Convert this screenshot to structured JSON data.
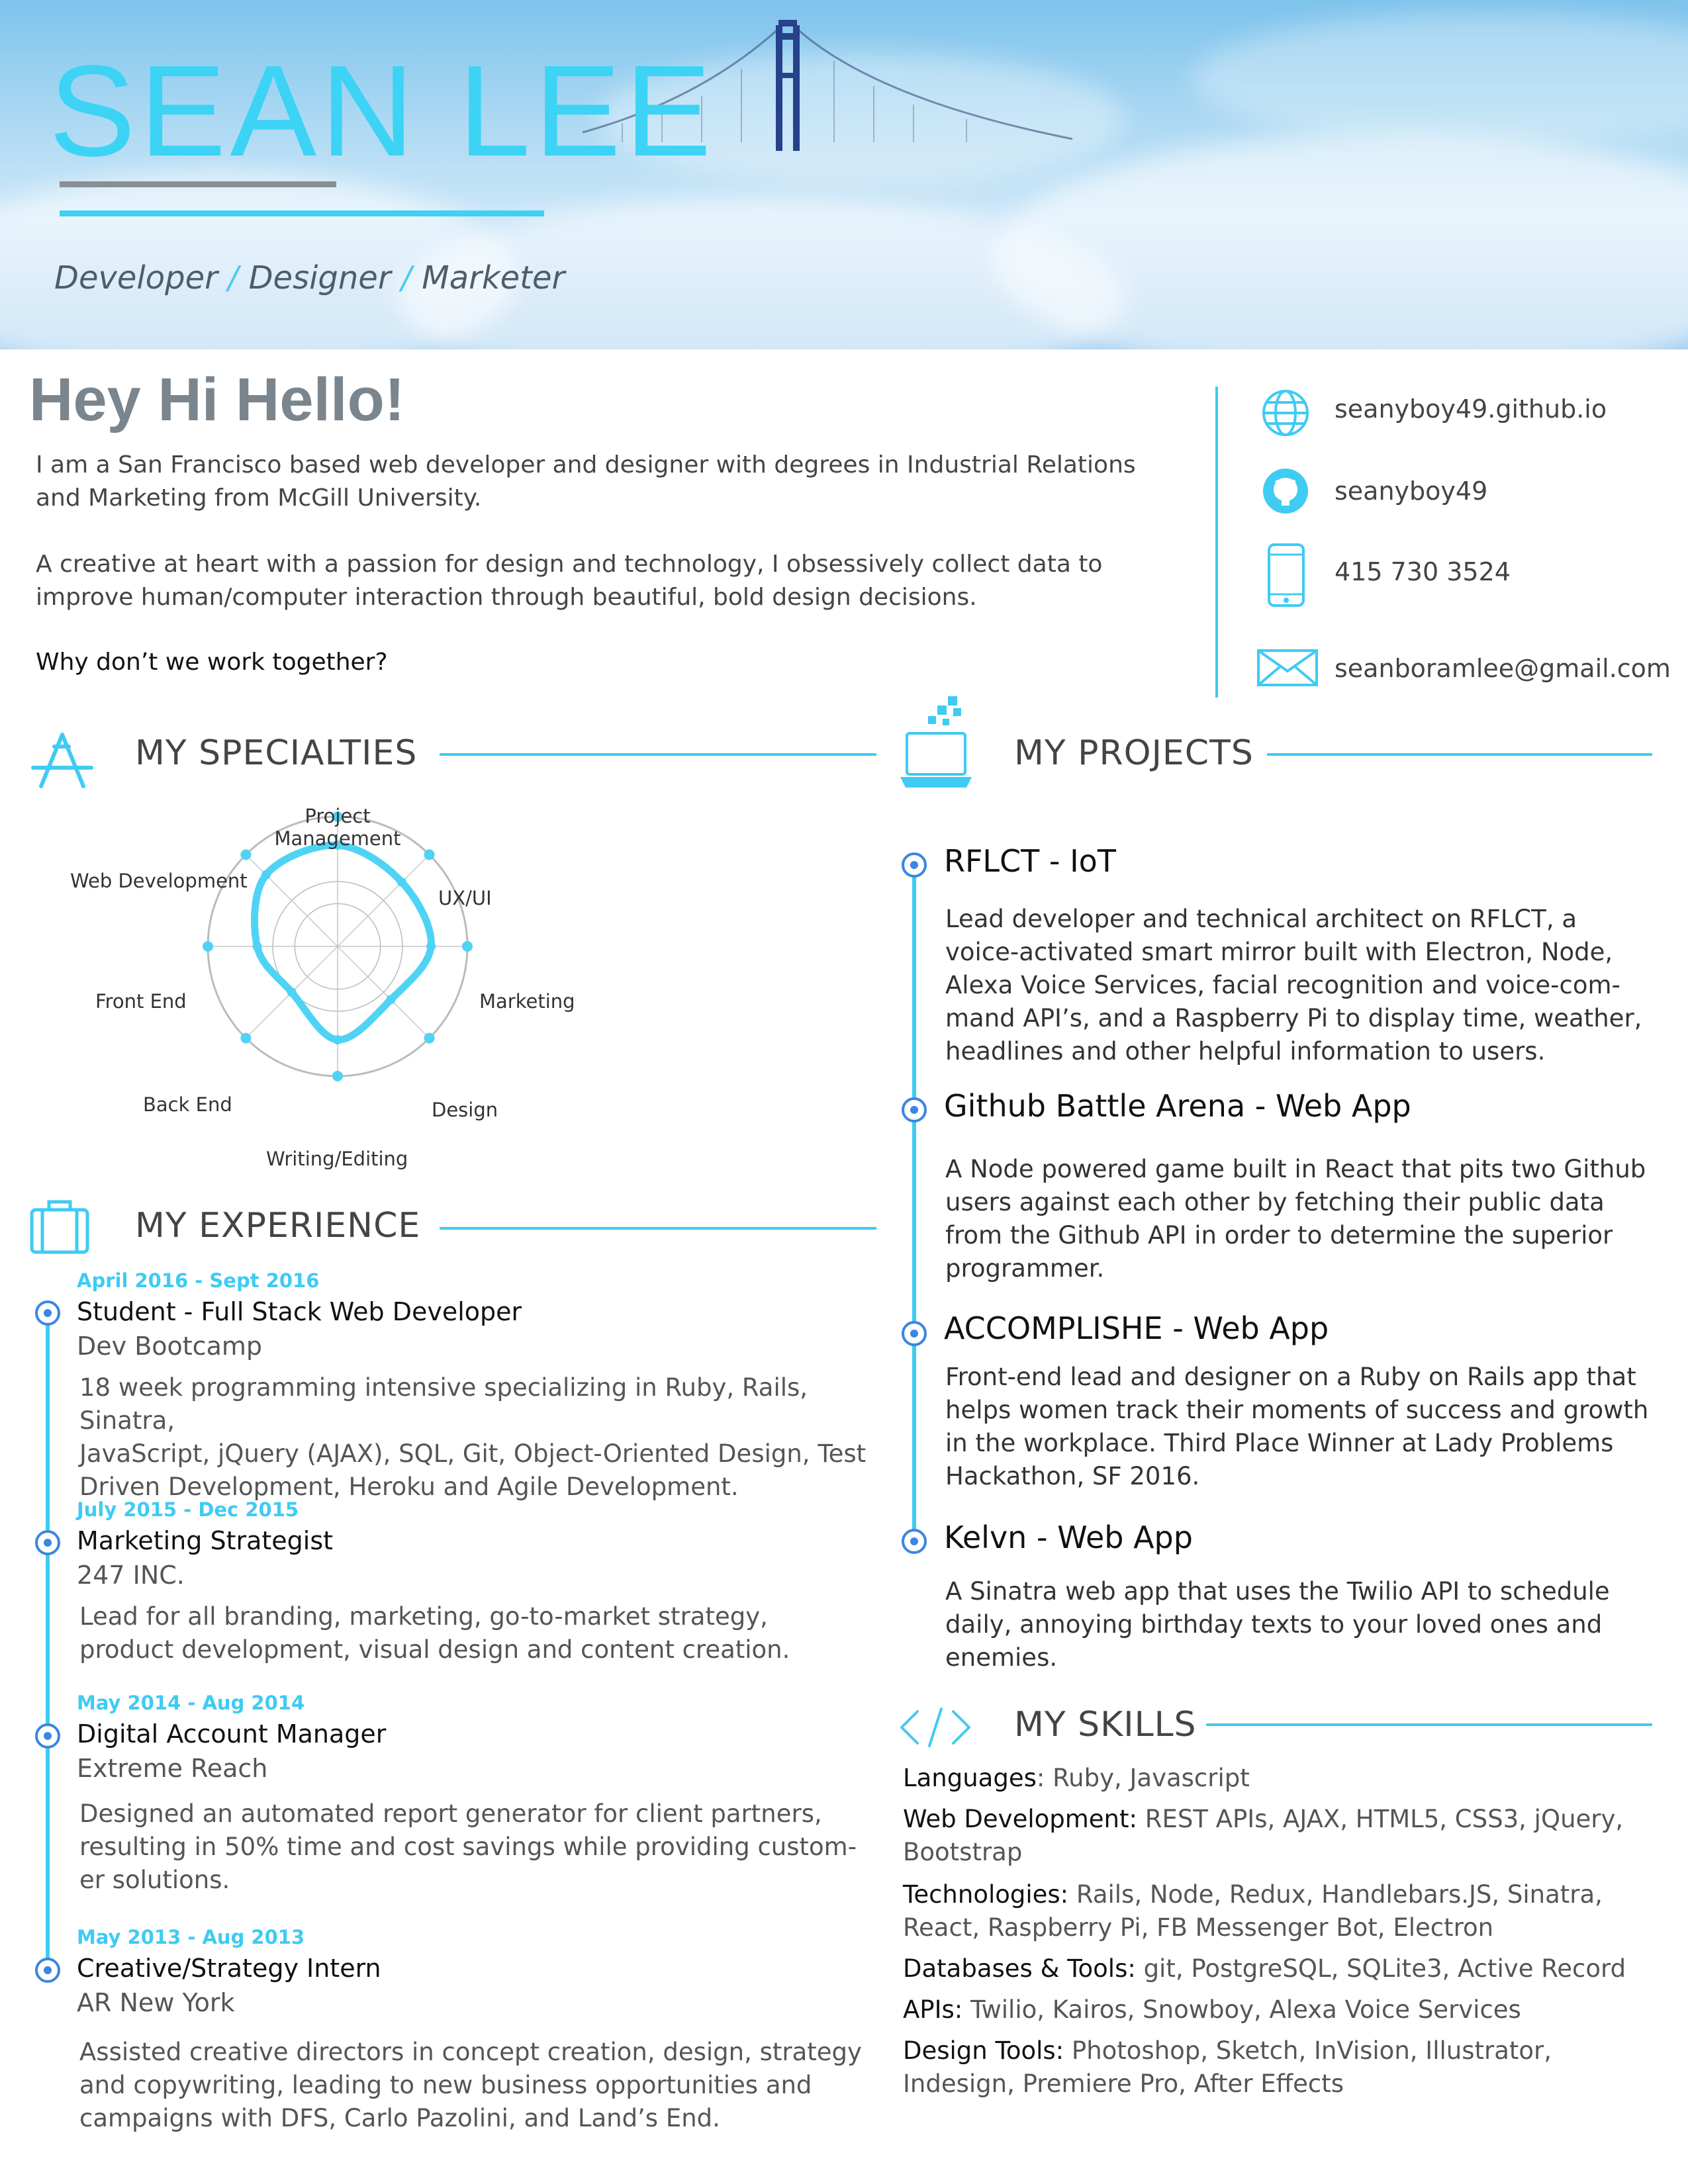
{
  "header": {
    "name": "SEAN LEE",
    "tagline": {
      "role1": "Developer",
      "role2": "Designer",
      "role3": "Marketer",
      "separator": "/"
    }
  },
  "intro": {
    "heading": "Hey Hi Hello!",
    "paragraph1_line1": "I am a San Francisco based web developer and designer with degrees in Industrial Relations",
    "paragraph1_line2": "and Marketing from McGill University.",
    "paragraph2_line1": "A creative at heart with a passion for design and technology, I obsessively collect data to",
    "paragraph2_line2": "improve human/computer interaction through beautiful, bold design decisions.",
    "call_to_action": "Why don’t we work together?"
  },
  "contact": {
    "website": "seanyboy49.github.io",
    "github": "seanyboy49",
    "phone": "415 730 3524",
    "email": "seanboramlee@gmail.com"
  },
  "specialties": {
    "title": "MY SPECIALTIES",
    "labels": {
      "project_line1": "Project",
      "project_line2": "Management",
      "uxui": "UX/UI",
      "marketing": "Marketing",
      "design": "Design",
      "writing": "Writing/Editing",
      "backend": "Back End",
      "frontend": "Front End",
      "webdev": "Web Development"
    },
    "chart_data": {
      "type": "radar",
      "categories": [
        "Project Management",
        "UX/UI",
        "Marketing",
        "Design",
        "Writing/Editing",
        "Back End",
        "Front End",
        "Web Development"
      ],
      "values": [
        0.78,
        0.7,
        0.72,
        0.58,
        0.72,
        0.5,
        0.62,
        0.78
      ],
      "max": 1.0,
      "color": "#4fd3f5"
    }
  },
  "experience": {
    "title": "MY EXPERIENCE",
    "items": [
      {
        "date": "April 2016 - Sept 2016",
        "title": "Student - Full Stack Web Developer",
        "org": "Dev Bootcamp",
        "desc1": "18 week programming intensive specializing in Ruby, Rails, Sinatra,",
        "desc2": "JavaScript, jQuery (AJAX), SQL, Git, Object-Oriented Design, Test",
        "desc3": "Driven Development, Heroku and Agile Development."
      },
      {
        "date": "July 2015 - Dec 2015",
        "title": "Marketing Strategist",
        "org": "247 INC.",
        "desc1": "Lead for all branding, marketing, go-to-market strategy,",
        "desc2": "product development, visual design and content creation.",
        "desc3": ""
      },
      {
        "date": "May 2014 - Aug 2014",
        "title": "Digital Account Manager",
        "org": "Extreme Reach",
        "desc1": "Designed an automated report generator for client partners,",
        "desc2": "resulting in 50% time and cost savings while providing custom-",
        "desc3": "er solutions."
      },
      {
        "date": "May 2013 - Aug 2013",
        "title": "Creative/Strategy Intern",
        "org": "AR New York",
        "desc1": "Assisted creative directors in concept creation, design, strategy",
        "desc2": "and copywriting, leading to new business opportunities and",
        "desc3": "campaigns with DFS, Carlo Pazolini, and Land’s End."
      }
    ]
  },
  "projects": {
    "title": "MY PROJECTS",
    "items": [
      {
        "title": "RFLCT - IoT",
        "lines": [
          "Lead developer and technical architect on RFLCT, a",
          "voice-activated smart mirror built with Electron, Node,",
          "Alexa Voice Services, facial recognition and voice-com-",
          "mand API’s, and a Raspberry Pi to display time, weather,",
          "headlines and other helpful information to users."
        ]
      },
      {
        "title": "Github Battle Arena - Web App",
        "lines": [
          "A Node powered game built in React that pits two Github",
          "users against each other by fetching their public data",
          "from the Github API in order to determine the superior",
          "programmer."
        ]
      },
      {
        "title": "ACCOMPLISHE - Web App",
        "lines": [
          "Front-end lead and designer on a Ruby on Rails app that",
          "helps women track their moments of success and growth",
          "in the workplace. Third Place Winner at Lady Problems",
          "Hackathon, SF 2016."
        ]
      },
      {
        "title": "Kelvn - Web App",
        "lines": [
          "A Sinatra web app that uses the Twilio API to schedule",
          "daily, annoying birthday texts to your loved ones and",
          "enemies."
        ]
      }
    ]
  },
  "skills": {
    "title": "MY SKILLS",
    "languages_label": "Languages",
    "languages": ": Ruby, Javascript",
    "webdev_label": "Web Development:",
    "webdev_line1": " REST APIs, AJAX, HTML5, CSS3, jQuery,",
    "webdev_line2": "Bootstrap",
    "tech_label": "Technologies:",
    "tech_line1": " Rails, Node, Redux, Handlebars.JS, Sinatra,",
    "tech_line2": "React, Raspberry Pi, FB Messenger Bot, Electron",
    "db_label": "Databases & Tools:",
    "db": " git, PostgreSQL, SQLite3, Active Record",
    "apis_label": "APIs:",
    "apis": " Twilio, Kairos, Snowboy, Alexa Voice Services",
    "design_label": "Design Tools:",
    "design_line1": " Photoshop, Sketch, InVision, Illustrator,",
    "design_line2": "Indesign, Premiere Pro, After Effects"
  },
  "colors": {
    "accent": "#3fcbf2",
    "bullet": "#3a86e0",
    "heading_grey": "#7a858e"
  }
}
